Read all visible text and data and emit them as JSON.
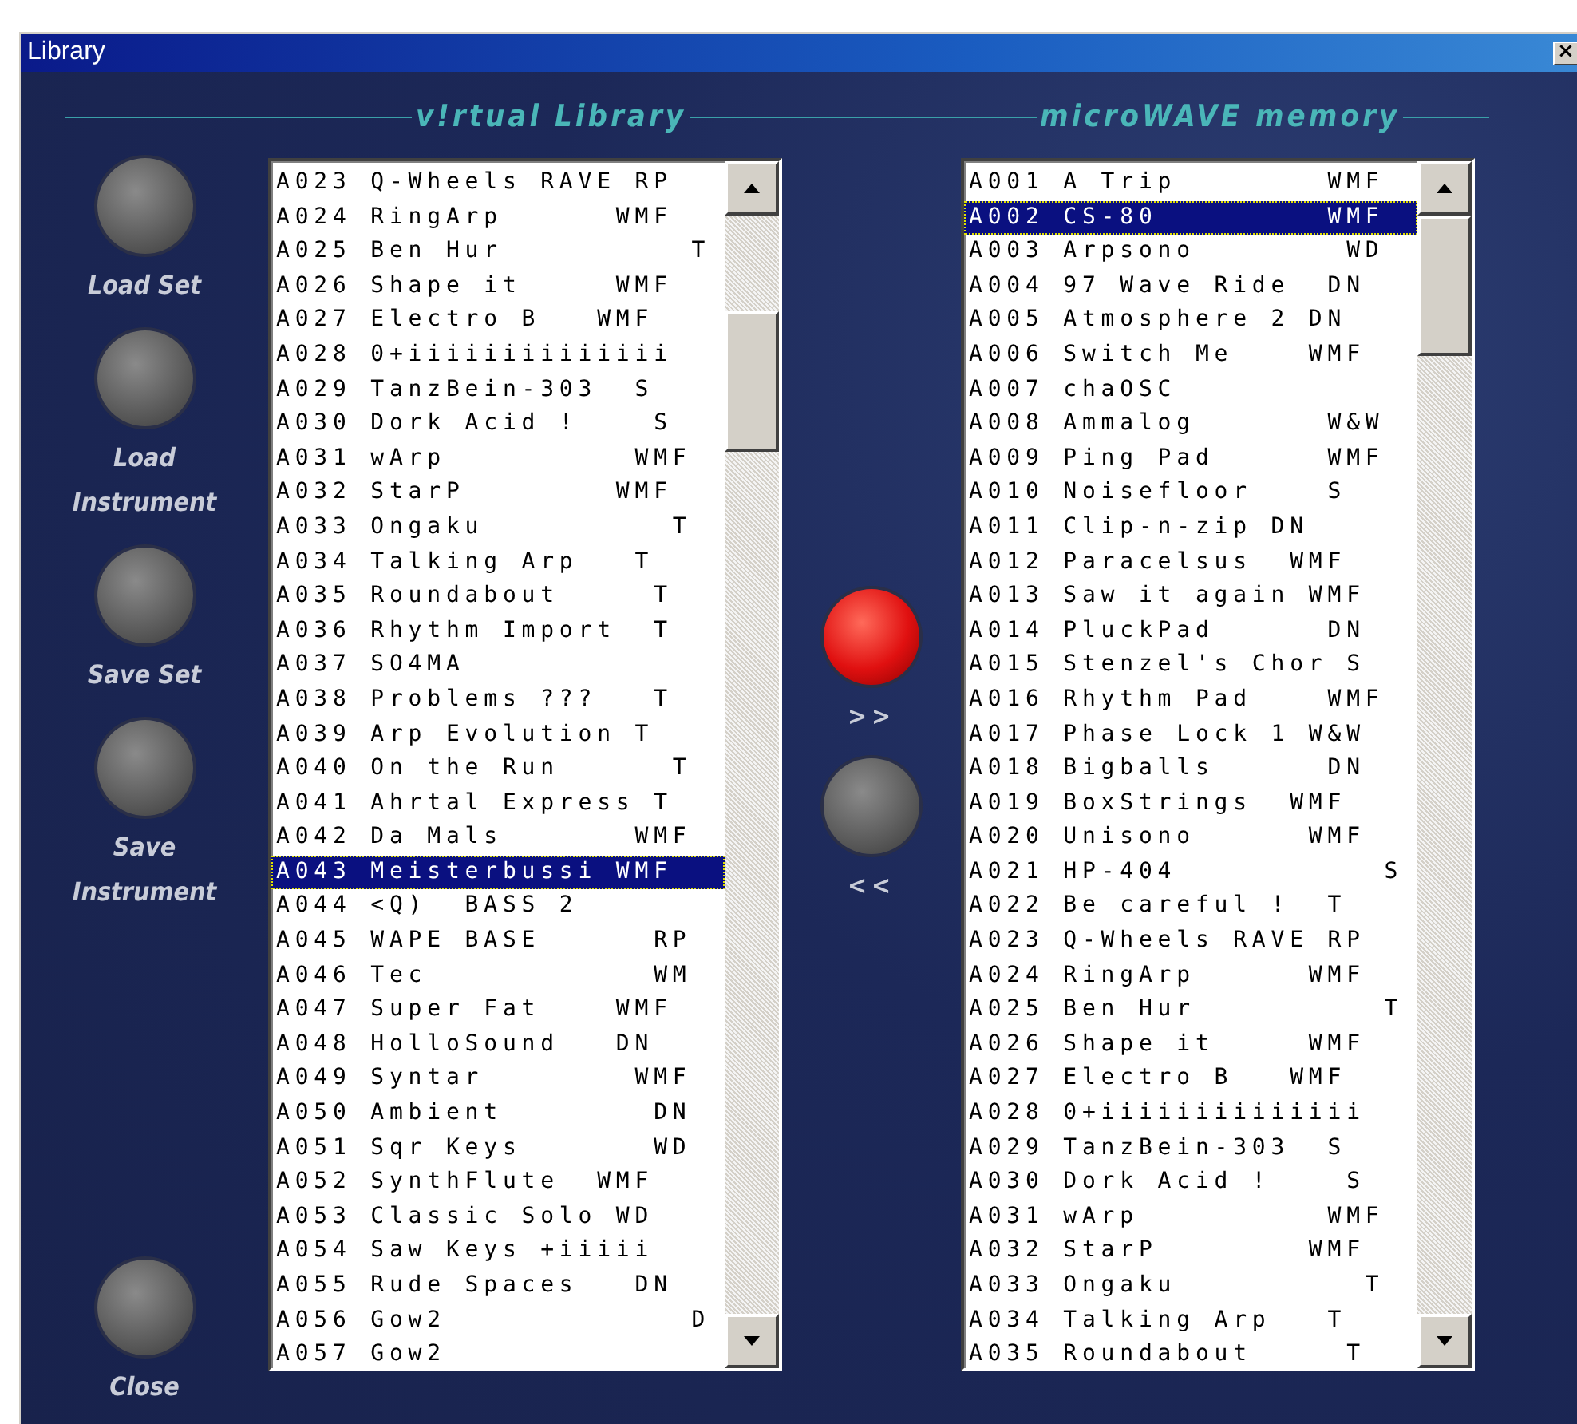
{
  "window": {
    "title": "Library",
    "close": "×"
  },
  "sections": [
    "v!rtual Library",
    "microWAVE memory"
  ],
  "side_buttons": [
    {
      "label": "Load Set",
      "kind": "top"
    },
    {
      "label": "Load Instrument",
      "kind": "top"
    },
    {
      "label": "Save Set",
      "kind": "top"
    },
    {
      "label": "Save Instrument",
      "kind": "top"
    },
    {
      "label": "Close",
      "kind": "bottom"
    }
  ],
  "transfer_buttons": [
    {
      "label": ">>",
      "kind": "red"
    },
    {
      "label": "<<",
      "kind": "grey"
    }
  ],
  "virtual_library": [
    {
      "text": "A023 Q-Wheels RAVE RP",
      "selected": false
    },
    {
      "text": "A024 RingArp      WMF",
      "selected": false
    },
    {
      "text": "A025 Ben Hur          T",
      "selected": false
    },
    {
      "text": "A026 Shape it     WMF",
      "selected": false
    },
    {
      "text": "A027 Electro B   WMF",
      "selected": false
    },
    {
      "text": "A028 0+iiiiiiiiiiiiii",
      "selected": false
    },
    {
      "text": "A029 TanzBein-303  S",
      "selected": false
    },
    {
      "text": "A030 Dork Acid !    S",
      "selected": false
    },
    {
      "text": "A031 wArp          WMF",
      "selected": false
    },
    {
      "text": "A032 StarP        WMF",
      "selected": false
    },
    {
      "text": "A033 Ongaku          T",
      "selected": false
    },
    {
      "text": "A034 Talking Arp   T",
      "selected": false
    },
    {
      "text": "A035 Roundabout     T",
      "selected": false
    },
    {
      "text": "A036 Rhythm Import  T",
      "selected": false
    },
    {
      "text": "A037 SO4MA",
      "selected": false
    },
    {
      "text": "A038 Problems ???   T",
      "selected": false
    },
    {
      "text": "A039 Arp Evolution T",
      "selected": false
    },
    {
      "text": "A040 On the Run      T",
      "selected": false
    },
    {
      "text": "A041 Ahrtal Express T",
      "selected": false
    },
    {
      "text": "A042 Da Mals       WMF",
      "selected": false
    },
    {
      "text": "A043 Meisterbussi WMF",
      "selected": true
    },
    {
      "text": "A044 <Q)  BASS 2",
      "selected": false
    },
    {
      "text": "A045 WAPE BASE      RP",
      "selected": false
    },
    {
      "text": "A046 Tec            WM",
      "selected": false
    },
    {
      "text": "A047 Super Fat    WMF",
      "selected": false
    },
    {
      "text": "A048 HolloSound   DN",
      "selected": false
    },
    {
      "text": "A049 Syntar        WMF",
      "selected": false
    },
    {
      "text": "A050 Ambient        DN",
      "selected": false
    },
    {
      "text": "A051 Sqr Keys       WD",
      "selected": false
    },
    {
      "text": "A052 SynthFlute  WMF",
      "selected": false
    },
    {
      "text": "A053 Classic Solo WD",
      "selected": false
    },
    {
      "text": "A054 Saw Keys +iiiii",
      "selected": false
    },
    {
      "text": "A055 Rude Spaces   DN",
      "selected": false
    },
    {
      "text": "A056 Gow2             D",
      "selected": false
    },
    {
      "text": "A057 Gow2",
      "selected": false
    }
  ],
  "microwave_memory": [
    {
      "text": "A001 A Trip        WMF",
      "selected": false
    },
    {
      "text": "A002 CS-80         WMF",
      "selected": true
    },
    {
      "text": "A003 Arpsono        WD",
      "selected": false
    },
    {
      "text": "A004 97 Wave Ride  DN",
      "selected": false
    },
    {
      "text": "A005 Atmosphere 2 DN",
      "selected": false
    },
    {
      "text": "A006 Switch Me    WMF",
      "selected": false
    },
    {
      "text": "A007 chaOSC",
      "selected": false
    },
    {
      "text": "A008 Ammalog       W&W",
      "selected": false
    },
    {
      "text": "A009 Ping Pad      WMF",
      "selected": false
    },
    {
      "text": "A010 Noisefloor    S",
      "selected": false
    },
    {
      "text": "A011 Clip-n-zip DN",
      "selected": false
    },
    {
      "text": "A012 Paracelsus  WMF",
      "selected": false
    },
    {
      "text": "A013 Saw it again WMF",
      "selected": false
    },
    {
      "text": "A014 PluckPad      DN",
      "selected": false
    },
    {
      "text": "A015 Stenzel's Chor S",
      "selected": false
    },
    {
      "text": "A016 Rhythm Pad    WMF",
      "selected": false
    },
    {
      "text": "A017 Phase Lock 1 W&W",
      "selected": false
    },
    {
      "text": "A018 Bigballs      DN",
      "selected": false
    },
    {
      "text": "A019 BoxStrings  WMF",
      "selected": false
    },
    {
      "text": "A020 Unisono      WMF",
      "selected": false
    },
    {
      "text": "A021 HP-404           S",
      "selected": false
    },
    {
      "text": "A022 Be careful !  T",
      "selected": false
    },
    {
      "text": "A023 Q-Wheels RAVE RP",
      "selected": false
    },
    {
      "text": "A024 RingArp      WMF",
      "selected": false
    },
    {
      "text": "A025 Ben Hur          T",
      "selected": false
    },
    {
      "text": "A026 Shape it     WMF",
      "selected": false
    },
    {
      "text": "A027 Electro B   WMF",
      "selected": false
    },
    {
      "text": "A028 0+iiiiiiiiiiiiii",
      "selected": false
    },
    {
      "text": "A029 TanzBein-303  S",
      "selected": false
    },
    {
      "text": "A030 Dork Acid !    S",
      "selected": false
    },
    {
      "text": "A031 wArp          WMF",
      "selected": false
    },
    {
      "text": "A032 StarP        WMF",
      "selected": false
    },
    {
      "text": "A033 Ongaku          T",
      "selected": false
    },
    {
      "text": "A034 Talking Arp   T",
      "selected": false
    },
    {
      "text": "A035 Roundabout     T",
      "selected": false
    }
  ]
}
